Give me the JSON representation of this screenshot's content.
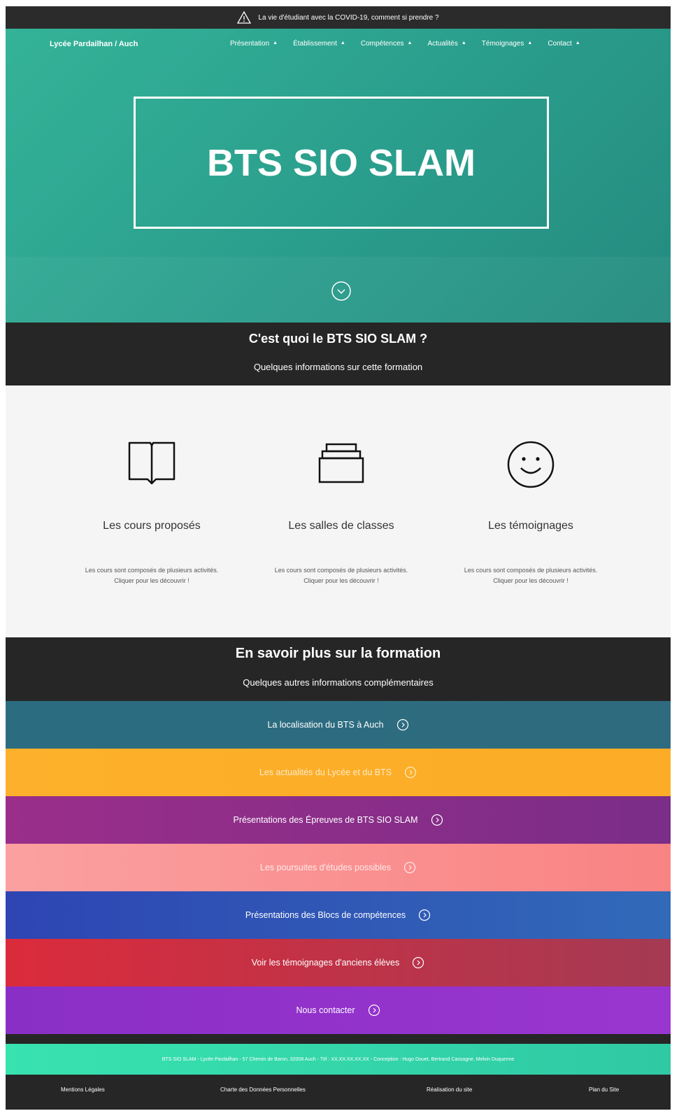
{
  "alert": {
    "text": "La vie d'étudiant avec la COVID-19, comment si prendre ?",
    "icon": "warning-triangle-icon"
  },
  "nav": {
    "brand": "Lycée Pardailhan / Auch",
    "items": [
      {
        "label": "Présentation"
      },
      {
        "label": "Établissement"
      },
      {
        "label": "Compétences"
      },
      {
        "label": "Actualités"
      },
      {
        "label": "Témoignages"
      },
      {
        "label": "Contact"
      }
    ],
    "caret": "▲"
  },
  "hero": {
    "title": "BTS SIO SLAM",
    "scroll_icon": "chevron-down-circle-icon"
  },
  "section1": {
    "title": "C'est quoi le BTS SIO SLAM ?",
    "subtitle": "Quelques informations sur cette formation"
  },
  "features": [
    {
      "title": "Les cours proposés",
      "desc_line1": "Les cours sont composés de plusieurs activités.",
      "desc_line2": "Cliquer pour les découvrir !",
      "icon": "open-book-icon"
    },
    {
      "title": "Les salles de classes",
      "desc_line1": "Les cours sont composés de plusieurs activités.",
      "desc_line2": "Cliquer pour les découvrir !",
      "icon": "archive-box-icon"
    },
    {
      "title": "Les témoignages",
      "desc_line1": "Les cours sont composés de plusieurs activités.",
      "desc_line2": "Cliquer pour les découvrir !",
      "icon": "smiley-icon"
    }
  ],
  "section2": {
    "title": "En savoir plus sur la formation",
    "subtitle": "Quelques autres informations complémentaires"
  },
  "links": [
    {
      "label": "La localisation du BTS à Auch"
    },
    {
      "label": "Les actualités du Lycée et du BTS"
    },
    {
      "label": "Présentations des Épreuves de BTS SIO SLAM"
    },
    {
      "label": "Les poursuites d'études possibles"
    },
    {
      "label": "Présentations des Blocs de compétences"
    },
    {
      "label": "Voir les témoignages d'anciens élèves"
    },
    {
      "label": "Nous contacter"
    }
  ],
  "footer": {
    "info": "BTS SIO SLAM - Lycée Pardailhan - 57 Chemin de Baron, 32008 Auch - Tél : XX.XX.XX.XX.XX - Conception : Hugo Douet, Bertrand Cassagne, Melvin Duquenne",
    "links": [
      "Mentions Légales",
      "Charte des Données Personnelles",
      "Réalisation du site",
      "Plan du Site"
    ]
  },
  "colors": {
    "hero": "#2a9d8c",
    "dark": "#262626",
    "strip_teal": "#2b6c80",
    "strip_orange": "#fdb02b",
    "strip_purple": "#9a2e8a",
    "strip_pink": "#fba0a0",
    "strip_blue": "#2e45b3",
    "strip_red": "#db2b3b",
    "strip_violet": "#8a2fc6",
    "footer_green": "#38e3b0"
  }
}
